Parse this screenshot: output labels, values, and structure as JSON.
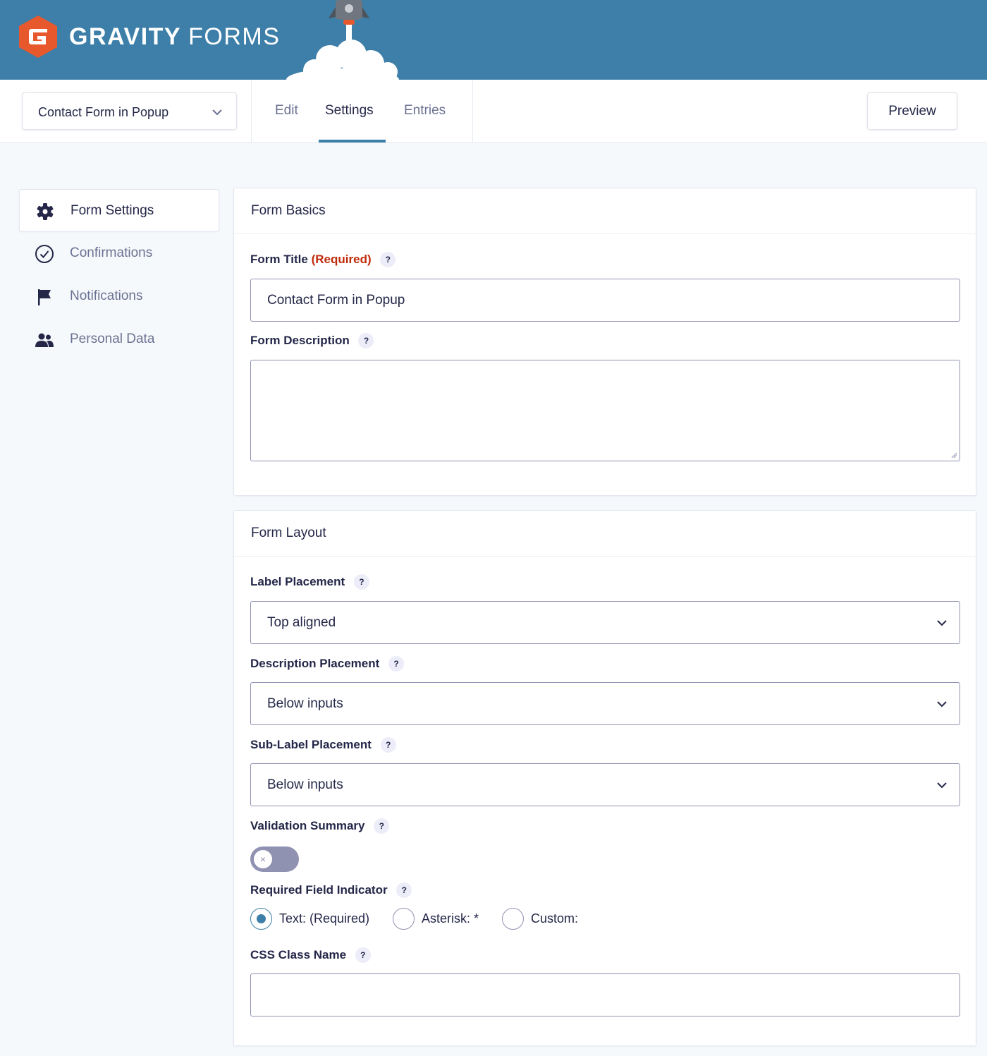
{
  "brand": {
    "name_bold": "GRAVITY",
    "name_thin": "FORMS",
    "color": "#3d7fa8",
    "logo_color": "#e8582d"
  },
  "toolbar": {
    "form_selector": "Contact Form in Popup",
    "tabs": [
      "Edit",
      "Settings",
      "Entries"
    ],
    "active_tab": "Settings",
    "preview_label": "Preview"
  },
  "sidebar": {
    "items": [
      {
        "label": "Form Settings",
        "icon": "gear-icon",
        "active": true
      },
      {
        "label": "Confirmations",
        "icon": "check-circle-icon",
        "active": false
      },
      {
        "label": "Notifications",
        "icon": "flag-icon",
        "active": false
      },
      {
        "label": "Personal Data",
        "icon": "users-icon",
        "active": false
      }
    ]
  },
  "basics": {
    "heading": "Form Basics",
    "title_label": "Form Title",
    "required_text": "(Required)",
    "title_value": "Contact Form in Popup",
    "description_label": "Form Description",
    "description_value": ""
  },
  "layout": {
    "heading": "Form Layout",
    "label_placement_label": "Label Placement",
    "label_placement_value": "Top aligned",
    "description_placement_label": "Description Placement",
    "description_placement_value": "Below inputs",
    "sublabel_placement_label": "Sub-Label Placement",
    "sublabel_placement_value": "Below inputs",
    "validation_summary_label": "Validation Summary",
    "validation_summary_on": false,
    "required_indicator_label": "Required Field Indicator",
    "required_options": [
      "Text: (Required)",
      "Asterisk: *",
      "Custom:"
    ],
    "required_selected": "Text: (Required)",
    "css_class_label": "CSS Class Name",
    "css_class_value": ""
  },
  "help_glyph": "?",
  "toggle_off_glyph": "×"
}
